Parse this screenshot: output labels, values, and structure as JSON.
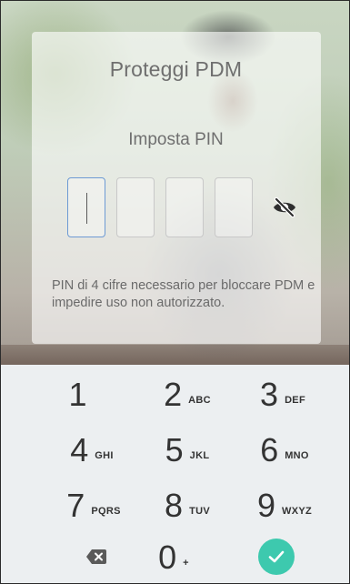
{
  "header": {
    "title": "Proteggi PDM",
    "subtitle": "Imposta PIN"
  },
  "pin": {
    "length": 4,
    "filled": 0,
    "visibility_icon": "eye-off-icon"
  },
  "description": "PIN di 4 cifre necessario per bloccare PDM e impedire uso non autorizzato.",
  "keypad": {
    "keys": [
      {
        "digit": "1",
        "letters": ""
      },
      {
        "digit": "2",
        "letters": "ABC"
      },
      {
        "digit": "3",
        "letters": "DEF"
      },
      {
        "digit": "4",
        "letters": "GHI"
      },
      {
        "digit": "5",
        "letters": "JKL"
      },
      {
        "digit": "6",
        "letters": "MNO"
      },
      {
        "digit": "7",
        "letters": "PQRS"
      },
      {
        "digit": "8",
        "letters": "TUV"
      },
      {
        "digit": "9",
        "letters": "WXYZ"
      },
      {
        "digit": "0",
        "letters": "+"
      }
    ],
    "backspace_icon": "backspace-icon",
    "confirm_icon": "checkmark-icon"
  },
  "colors": {
    "accent": "#3dc9ae",
    "active_border": "#6d9ad4",
    "keypad_bg": "#eceff1"
  }
}
